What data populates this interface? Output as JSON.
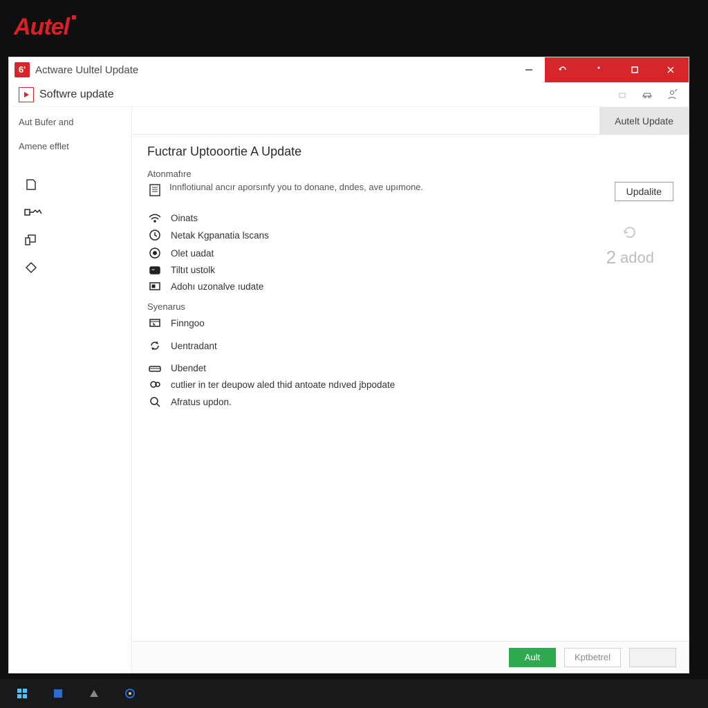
{
  "brand": "Autel",
  "titlebar": {
    "icon_label": "6'",
    "title": "Actware Uultel Update"
  },
  "subbar": {
    "title": "Softwre update"
  },
  "sidebar": {
    "text_items": [
      "Aut Bufer and",
      "Amene efflet"
    ]
  },
  "tab": {
    "label": "Autelt Update"
  },
  "page": {
    "heading": "Fuctrar Uptooortie A Update",
    "section1_label": "Atonmafıre",
    "description": "Innflotiunal ancır aporsınfy you to donane, dndes, ave upımone.",
    "update_btn": "Updalite",
    "group1": [
      "Oinats",
      "Netak Kgpanatia lscans",
      "Olet uadat",
      "Tiltıt ustolk",
      "Adohı uzonalve ıudate"
    ],
    "section2_label": "Syenarus",
    "group2": [
      "Finngoo",
      "Uentradant",
      "Ubendet",
      "cutlier in ter deupow aled thid antoate ndıved jbpodate",
      "Afratus updon."
    ],
    "watermark_text": "adod",
    "watermark_num": "2"
  },
  "footer": {
    "primary": "Ault",
    "secondary": "Kptbetrel"
  }
}
